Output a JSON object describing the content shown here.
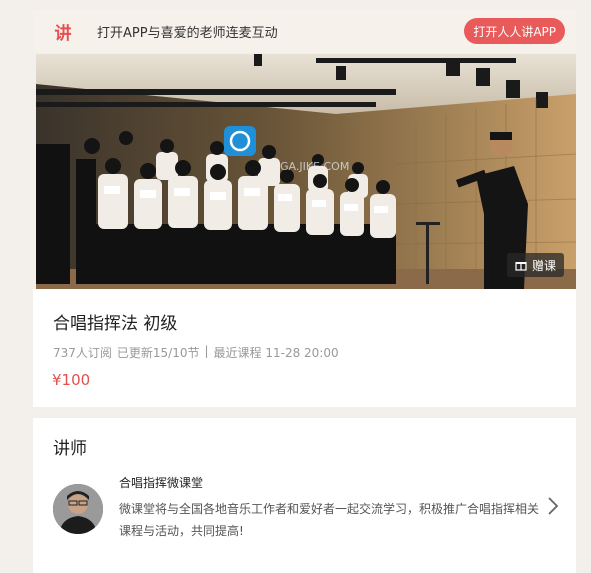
{
  "banner": {
    "logo_char": "讲",
    "message": "打开APP与喜爱的老师连麦互动",
    "open_app_label": "打开人人讲APP"
  },
  "hero": {
    "watermark_text": "GA.JIKE.COM",
    "gift_label": "赠课"
  },
  "course": {
    "title": "合唱指挥法 初级",
    "subscribers": "737人订阅",
    "updated": "已更新15/10节",
    "separator": "|",
    "latest": "最近课程 11-28 20:00",
    "price": "¥100"
  },
  "teacher": {
    "heading": "讲师",
    "name": "合唱指挥微课堂",
    "description": "微课堂将与全国各地音乐工作者和爱好者一起交流学习，积极推广合唱指挥相关课程与活动，共同提高!"
  },
  "colors": {
    "accent": "#e95b5b",
    "price": "#e0514d"
  }
}
